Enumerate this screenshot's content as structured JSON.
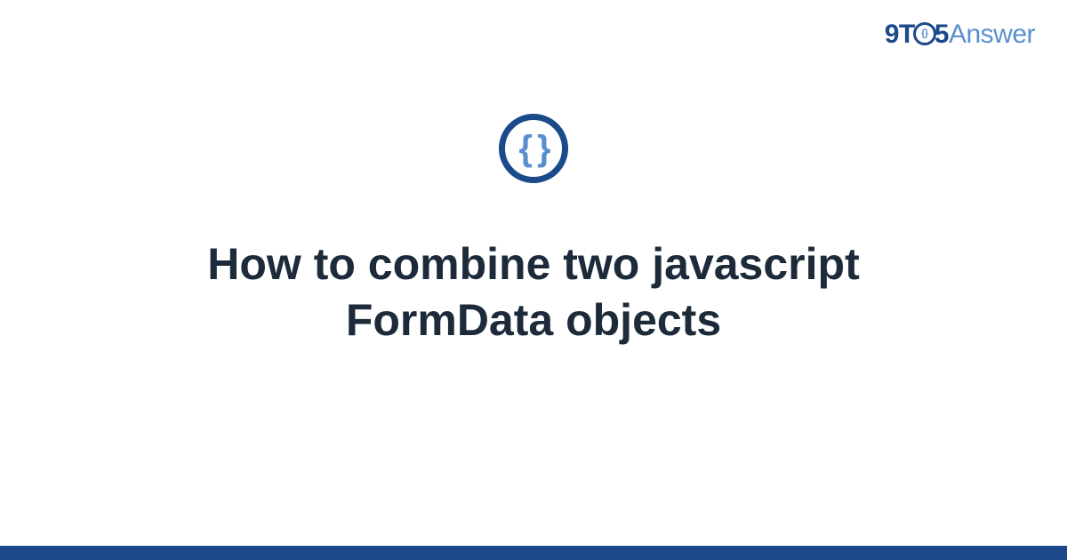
{
  "logo": {
    "part1": "9T",
    "circle_inner": "{}",
    "part2": "5",
    "part3": "Answer"
  },
  "icon": {
    "glyph": "{ }"
  },
  "title": "How to combine two javascript FormData objects"
}
